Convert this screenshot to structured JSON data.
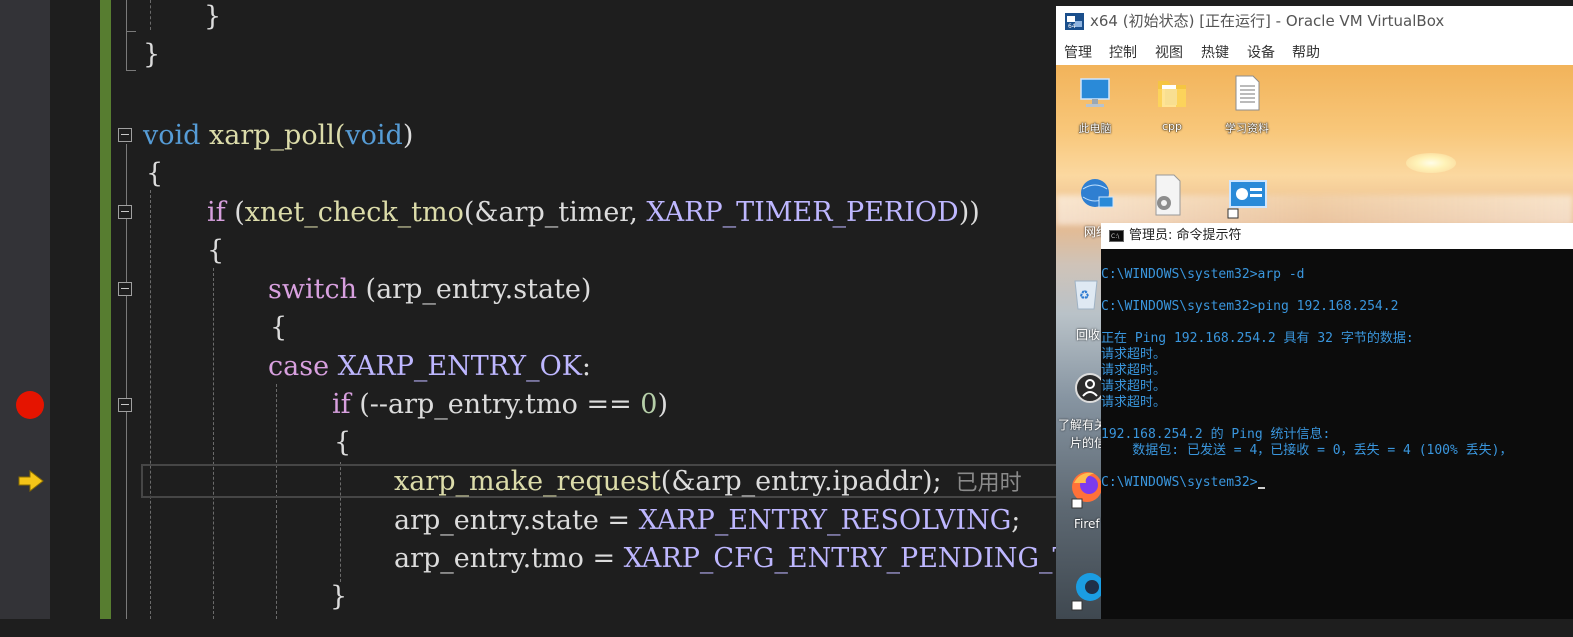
{
  "editor": {
    "lines": [
      {
        "id": "l0",
        "text": "}"
      },
      {
        "id": "l1",
        "text": "}"
      },
      {
        "id": "l3a",
        "text": "void"
      },
      {
        "id": "l3b",
        "text": " xarp_poll("
      },
      {
        "id": "l3c",
        "text": "void"
      },
      {
        "id": "l3d",
        "text": ")"
      },
      {
        "id": "l4",
        "text": "{"
      },
      {
        "id": "l5a",
        "text": "if"
      },
      {
        "id": "l5b",
        "text": " ("
      },
      {
        "id": "l5c",
        "text": "xnet_check_tmo"
      },
      {
        "id": "l5d",
        "text": "(&arp_timer, "
      },
      {
        "id": "l5e",
        "text": "XARP_TIMER_PERIOD"
      },
      {
        "id": "l5f",
        "text": "))"
      },
      {
        "id": "l6",
        "text": "{"
      },
      {
        "id": "l7a",
        "text": "switch"
      },
      {
        "id": "l7b",
        "text": " (arp_entry.state)"
      },
      {
        "id": "l8",
        "text": "{"
      },
      {
        "id": "l9a",
        "text": "case"
      },
      {
        "id": "l9b",
        "text": " "
      },
      {
        "id": "l9c",
        "text": "XARP_ENTRY_OK"
      },
      {
        "id": "l9d",
        "text": ":"
      },
      {
        "id": "l10a",
        "text": "if"
      },
      {
        "id": "l10b",
        "text": " (--arp_entry.tmo == "
      },
      {
        "id": "l10c",
        "text": "0"
      },
      {
        "id": "l10d",
        "text": ")"
      },
      {
        "id": "l11",
        "text": "{"
      },
      {
        "id": "l12a",
        "text": "xarp_make_request"
      },
      {
        "id": "l12b",
        "text": "(&arp_entry.ipaddr);"
      },
      {
        "id": "l12c",
        "text": "  已用时"
      },
      {
        "id": "l13a",
        "text": "arp_entry.state = "
      },
      {
        "id": "l13b",
        "text": "XARP_ENTRY_RESOLVING"
      },
      {
        "id": "l13c",
        "text": ";"
      },
      {
        "id": "l14a",
        "text": "arp_entry.tmo = "
      },
      {
        "id": "l14b",
        "text": "XARP_CFG_ENTRY_PENDING_TMO"
      },
      {
        "id": "l15",
        "text": "}"
      }
    ],
    "colors": {
      "background": "#1e1e1e",
      "keyword": "#569cd6",
      "control": "#d8a0df",
      "function": "#dcdcaa",
      "macro": "#beb7ff",
      "number": "#b5cea8",
      "breakpoint": "#e51400",
      "arrow": "#f5c518",
      "change_bar": "#577d30"
    },
    "icons": [
      "breakpoint-icon",
      "current-statement-arrow-icon",
      "collapse-icon"
    ]
  },
  "vbox": {
    "title": "x64 (初始状态) [正在运行] - Oracle VM VirtualBox",
    "menu": [
      "管理",
      "控制",
      "视图",
      "热键",
      "设备",
      "帮助"
    ],
    "desktop_icons": [
      {
        "label": "此电脑",
        "icon": "computer-icon"
      },
      {
        "label": "cpp",
        "icon": "folder-icon"
      },
      {
        "label": "学习资料",
        "icon": "document-icon"
      },
      {
        "label": "网络",
        "icon": "network-icon"
      },
      {
        "label": "回收",
        "icon": "recycle-bin-icon"
      },
      {
        "label": "了解有关",
        "icon": "learn-icon"
      },
      {
        "label": "片的信",
        "icon": "text-fragment"
      },
      {
        "label": "Firef",
        "icon": "firefox-icon"
      }
    ]
  },
  "cmd": {
    "title": "管理员: 命令提示符",
    "lines": [
      "C:\\WINDOWS\\system32>arp -d",
      "",
      "C:\\WINDOWS\\system32>ping 192.168.254.2",
      "",
      "正在 Ping 192.168.254.2 具有 32 字节的数据:",
      "请求超时。",
      "请求超时。",
      "请求超时。",
      "请求超时。",
      "",
      "192.168.254.2 的 Ping 统计信息:",
      "    数据包: 已发送 = 4，已接收 = 0，丢失 = 4 (100% 丢失)，",
      "",
      "C:\\WINDOWS\\system32>"
    ]
  }
}
